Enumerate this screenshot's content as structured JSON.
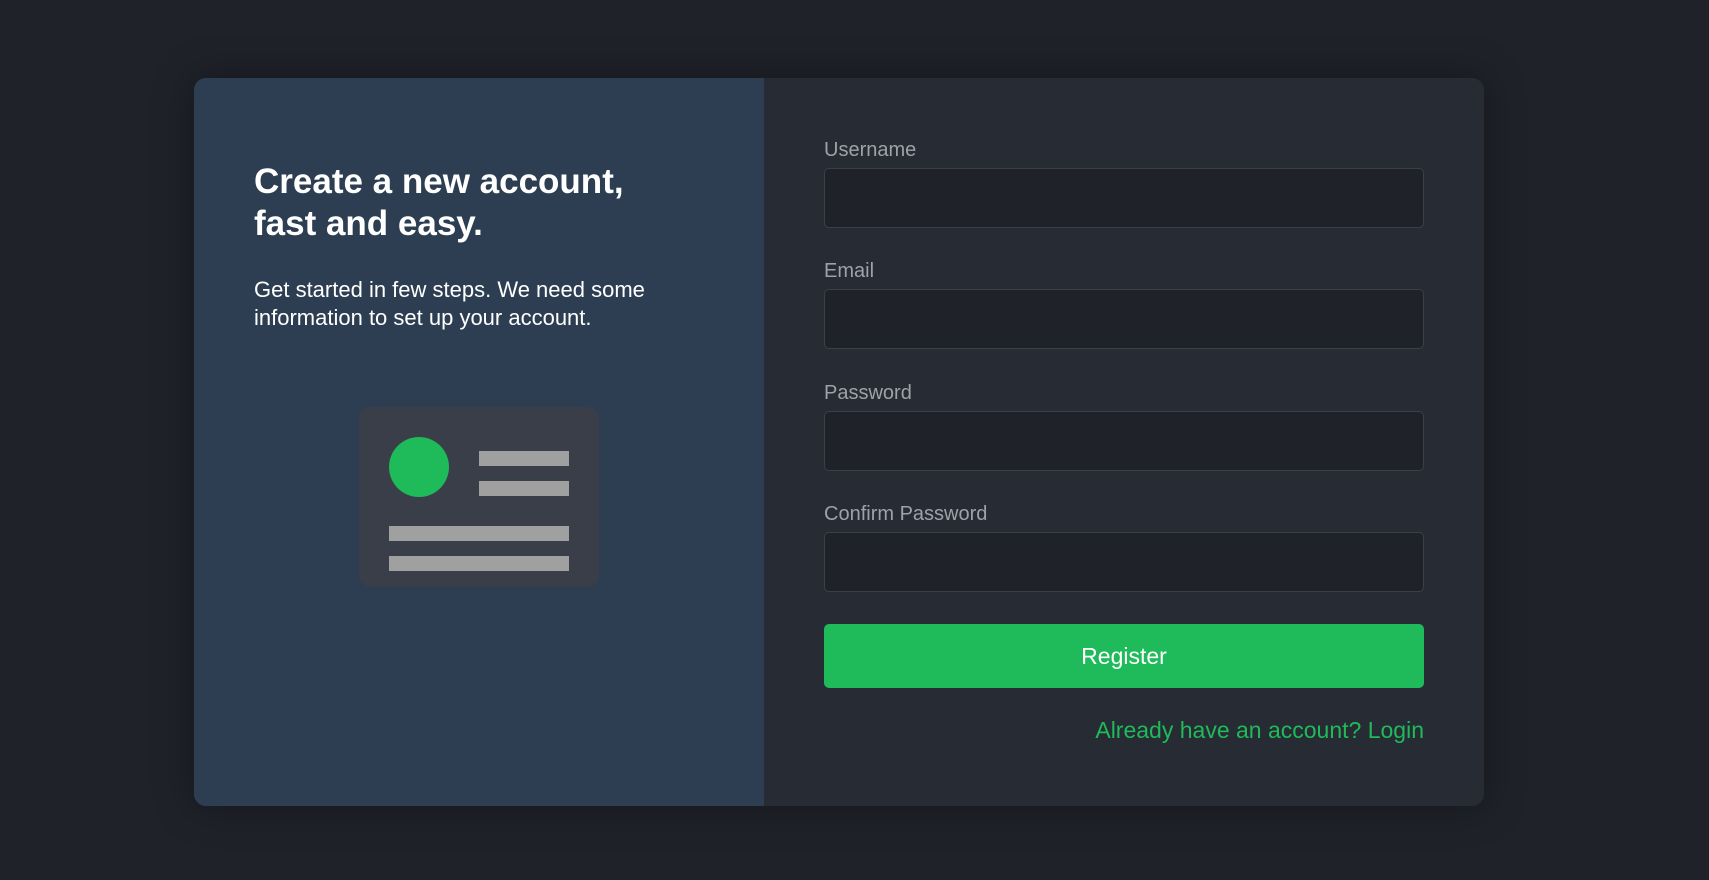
{
  "colors": {
    "accent": "#1fba59",
    "page_background": "#1f2229",
    "left_panel": "#2d3e52",
    "right_panel": "#272b34"
  },
  "intro": {
    "headline": "Create a new account, fast and easy.",
    "description": "Get started in few steps. We need some information to set up your account."
  },
  "illustration": {
    "icon": "id-card-icon"
  },
  "form": {
    "username": {
      "label": "Username",
      "value": "",
      "placeholder": ""
    },
    "email": {
      "label": "Email",
      "value": "",
      "placeholder": ""
    },
    "password": {
      "label": "Password",
      "value": "",
      "placeholder": ""
    },
    "confirm_password": {
      "label": "Confirm Password",
      "value": "",
      "placeholder": ""
    },
    "register_label": "Register",
    "login_link": "Already have an account? Login"
  }
}
